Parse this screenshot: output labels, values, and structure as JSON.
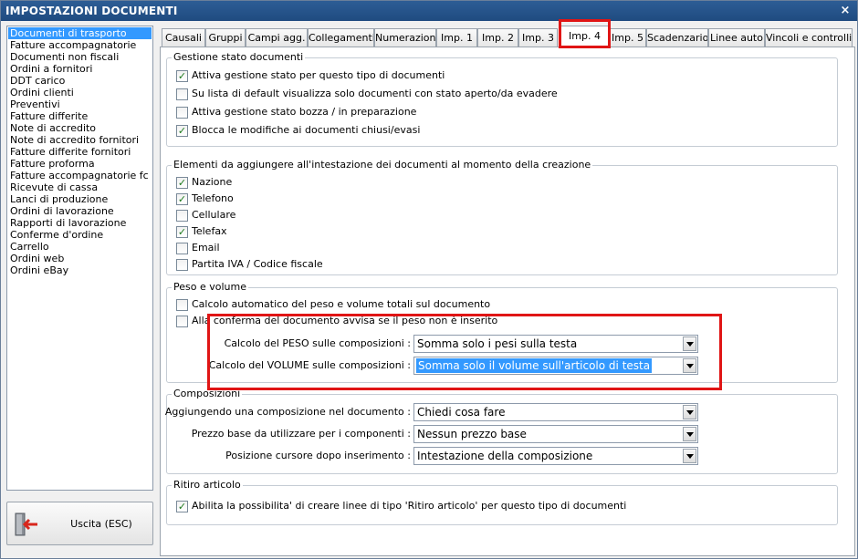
{
  "window": {
    "title": "IMPOSTAZIONI DOCUMENTI",
    "close_glyph": "×"
  },
  "doc_types": [
    "Documenti di trasporto",
    "Fatture accompagnatorie",
    "Documenti non fiscali",
    "Ordini a fornitori",
    "DDT carico",
    "Ordini clienti",
    "Preventivi",
    "Fatture differite",
    "Note di accredito",
    "Note di accredito fornitori",
    "Fatture differite fornitori",
    "Fatture proforma",
    "Fatture accompagnatorie fc",
    "Ricevute di cassa",
    "Lanci di produzione",
    "Ordini di lavorazione",
    "Rapporti di lavorazione",
    "Conferme d'ordine",
    "Carrello",
    "Ordini web",
    "Ordini eBay"
  ],
  "selected_doc_type": "Documenti di trasporto",
  "exit_button": {
    "label": "Uscita (ESC)",
    "icon": "exit-door-icon"
  },
  "tabs": [
    "Causali",
    "Gruppi",
    "Campi agg.",
    "Collegamenti",
    "Numerazioni",
    "Imp. 1",
    "Imp. 2",
    "Imp. 3",
    "Imp. 4",
    "Imp. 5",
    "Scadenzario",
    "Linee auto",
    "Vincoli e controlli"
  ],
  "active_tab": "Imp. 4",
  "stato": {
    "title": "Gestione stato documenti",
    "options": [
      {
        "label": "Attiva gestione stato per questo tipo di documenti",
        "checked": true
      },
      {
        "label": "Su lista di default visualizza solo documenti con stato aperto/da evadere",
        "checked": false
      },
      {
        "label": "Attiva gestione stato bozza / in preparazione",
        "checked": false
      },
      {
        "label": "Blocca le modifiche ai documenti chiusi/evasi",
        "checked": true
      }
    ]
  },
  "intestazione": {
    "title": "Elementi da aggiungere all'intestazione dei documenti al momento della creazione",
    "options": [
      {
        "label": "Nazione",
        "checked": true
      },
      {
        "label": "Telefono",
        "checked": true
      },
      {
        "label": "Cellulare",
        "checked": false
      },
      {
        "label": "Telefax",
        "checked": true
      },
      {
        "label": "Email",
        "checked": false
      },
      {
        "label": "Partita IVA / Codice fiscale",
        "checked": false
      }
    ]
  },
  "peso": {
    "title": "Peso e volume",
    "options": [
      {
        "label": "Calcolo automatico del peso e volume totali sul documento",
        "checked": false
      },
      {
        "label": "Alla conferma del documento avvisa se il peso non è inserito",
        "checked": false
      }
    ],
    "peso_label": "Calcolo del PESO sulle composizioni :",
    "peso_value": "Somma solo i pesi sulla testa",
    "volume_label": "Calcolo del VOLUME sulle composizioni :",
    "volume_value": "Somma solo il volume sull'articolo di testa"
  },
  "composizioni": {
    "title": "Composizioni",
    "fields": [
      {
        "label": "Aggiungendo una composizione nel documento :",
        "value": "Chiedi cosa fare"
      },
      {
        "label": "Prezzo base da utilizzare per i componenti :",
        "value": "Nessun prezzo base"
      },
      {
        "label": "Posizione cursore dopo inserimento :",
        "value": "Intestazione della composizione"
      }
    ]
  },
  "ritiro": {
    "title": "Ritiro articolo",
    "option": {
      "label": "Abilita la possibilita' di creare linee di tipo 'Ritiro articolo' per questo tipo di documenti",
      "checked": true
    }
  },
  "colors": {
    "titlebar": "#1f4b80",
    "selection": "#3399ff",
    "highlight_box": "#e01515",
    "checkmark": "#1c7a1c"
  }
}
